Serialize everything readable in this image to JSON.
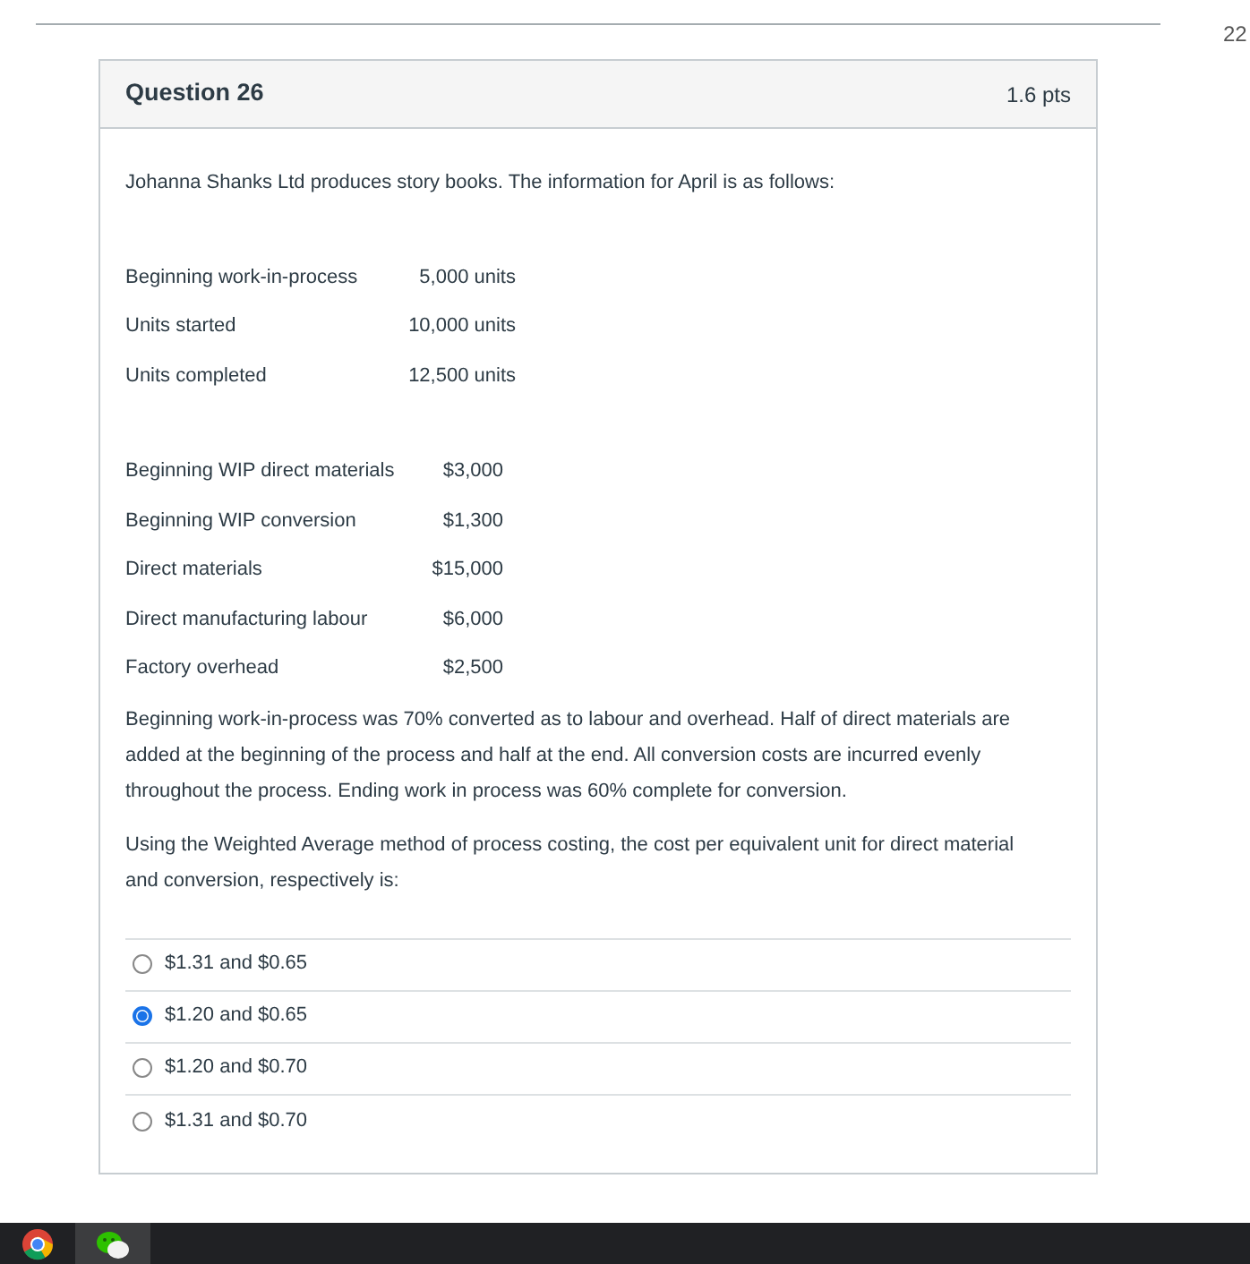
{
  "side_text": "22",
  "question": {
    "title": "Question 26",
    "points": "1.6 pts",
    "intro": "Johanna Shanks Ltd produces story books. The information for April is as follows:",
    "tables": [
      {
        "rows": [
          {
            "label": "Beginning work-in-process",
            "value": "5,000 units"
          },
          {
            "label": "Units started",
            "value": "10,000 units"
          },
          {
            "label": "Units completed",
            "value": "12,500 units"
          }
        ]
      },
      {
        "rows": [
          {
            "label": "Beginning WIP direct materials",
            "value": "$3,000"
          },
          {
            "label": "Beginning WIP conversion",
            "value": "$1,300"
          },
          {
            "label": "Direct materials",
            "value": "$15,000"
          },
          {
            "label": "Direct manufacturing labour",
            "value": "$6,000"
          },
          {
            "label": "Factory overhead",
            "value": "$2,500"
          }
        ]
      }
    ],
    "paragraphs": [
      "Beginning work-in-process was 70% converted as to labour and overhead. Half of direct materials are added at the beginning of the process and half at the end. All conversion costs are incurred evenly throughout the process. Ending work in process was 60% complete for conversion.",
      "Using the Weighted Average method of process costing, the cost per equivalent unit for direct material and conversion, respectively is:"
    ],
    "answers": [
      {
        "label": "$1.31 and $0.65",
        "selected": false
      },
      {
        "label": "$1.20 and $0.65",
        "selected": true
      },
      {
        "label": "$1.20 and $0.70",
        "selected": false
      },
      {
        "label": "$1.31 and $0.70",
        "selected": false
      }
    ]
  },
  "taskbar": {
    "apps": [
      {
        "kind": "browser",
        "selected": false
      },
      {
        "kind": "chat",
        "selected": true
      }
    ]
  }
}
